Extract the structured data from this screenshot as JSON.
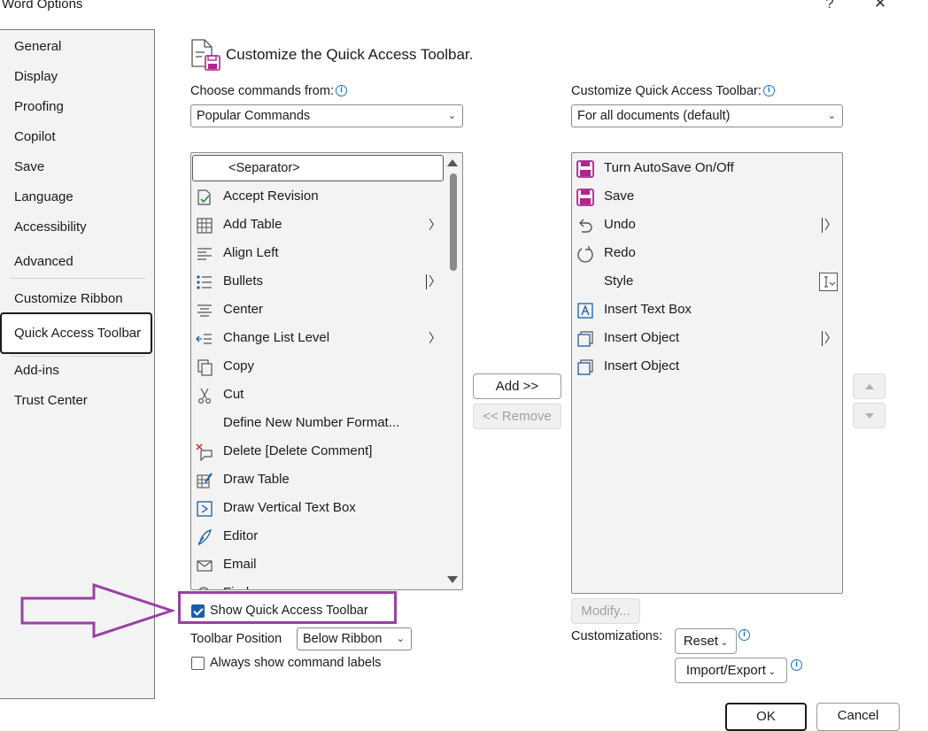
{
  "window": {
    "title": "Word Options",
    "help_glyph": "?",
    "close_glyph": "✕"
  },
  "sidebar": {
    "items": [
      {
        "label": "General"
      },
      {
        "label": "Display"
      },
      {
        "label": "Proofing"
      },
      {
        "label": "Copilot"
      },
      {
        "label": "Save"
      },
      {
        "label": "Language"
      },
      {
        "label": "Accessibility"
      },
      {
        "label": "Advanced"
      },
      {
        "label": "Customize Ribbon"
      },
      {
        "label": "Quick Access Toolbar",
        "selected": true
      },
      {
        "label": "Add-ins"
      },
      {
        "label": "Trust Center"
      }
    ]
  },
  "main": {
    "heading": "Customize the Quick Access Toolbar.",
    "choose_label": "Choose commands from:",
    "choose_value": "Popular Commands",
    "customize_label": "Customize Quick Access Toolbar:",
    "customize_value": "For all documents (default)",
    "commands": [
      {
        "label": "<Separator>",
        "icon": "separator"
      },
      {
        "label": "Accept Revision",
        "icon": "accept-revision-icon"
      },
      {
        "label": "Add Table",
        "icon": "table-icon",
        "submenu": true
      },
      {
        "label": "Align Left",
        "icon": "align-left-icon"
      },
      {
        "label": "Bullets",
        "icon": "bullets-icon",
        "split": true
      },
      {
        "label": "Center",
        "icon": "align-center-icon"
      },
      {
        "label": "Change List Level",
        "icon": "list-level-icon",
        "submenu": true
      },
      {
        "label": "Copy",
        "icon": "copy-icon"
      },
      {
        "label": "Cut",
        "icon": "scissors-icon"
      },
      {
        "label": "Define New Number Format...",
        "icon": ""
      },
      {
        "label": "Delete [Delete Comment]",
        "icon": "delete-comment-icon"
      },
      {
        "label": "Draw Table",
        "icon": "draw-table-icon"
      },
      {
        "label": "Draw Vertical Text Box",
        "icon": "vertical-text-box-icon"
      },
      {
        "label": "Editor",
        "icon": "editor-icon"
      },
      {
        "label": "Email",
        "icon": "email-icon"
      },
      {
        "label": "Find",
        "icon": "search-icon"
      }
    ],
    "toolbar_items": [
      {
        "label": "Turn AutoSave On/Off",
        "icon": "autosave-icon"
      },
      {
        "label": "Save",
        "icon": "save-icon"
      },
      {
        "label": "Undo",
        "icon": "undo-icon",
        "split": true
      },
      {
        "label": "Redo",
        "icon": "redo-icon"
      },
      {
        "label": "Style",
        "icon": "",
        "style_control": true
      },
      {
        "label": "Insert Text Box",
        "icon": "text-box-icon"
      },
      {
        "label": "Insert Object",
        "icon": "object-icon",
        "split": true
      },
      {
        "label": "Insert Object",
        "icon": "object-icon"
      }
    ],
    "add_button": "Add >>",
    "remove_button": "<< Remove",
    "modify_button": "Modify...",
    "show_qat_label": "Show Quick Access Toolbar",
    "show_qat_checked": true,
    "toolbar_position_label": "Toolbar Position",
    "toolbar_position_value": "Below Ribbon",
    "always_show_labels": "Always show command labels",
    "always_show_checked": false,
    "customizations_label": "Customizations:",
    "reset_button": "Reset",
    "import_export_button": "Import/Export",
    "ok_button": "OK",
    "cancel_button": "Cancel"
  },
  "colors": {
    "accent_purple": "#9b3fa5",
    "checkbox_blue": "#1a5ea8",
    "info_blue": "#1a73c9",
    "save_magenta": "#b0258e"
  }
}
